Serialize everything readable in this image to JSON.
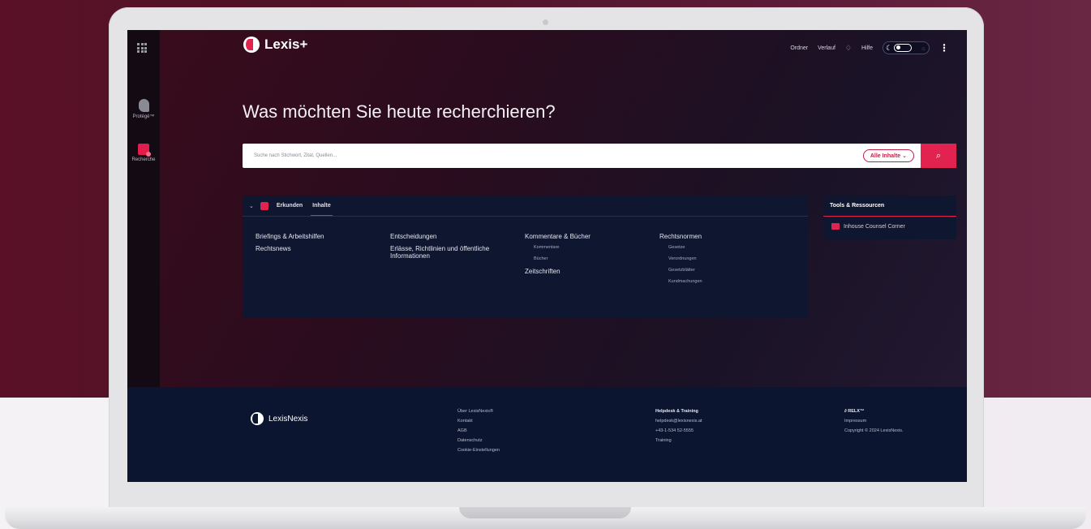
{
  "topnav": {
    "ordner": "Ordner",
    "verlauf": "Verlauf",
    "hilfe": "Hilfe"
  },
  "brand": {
    "name": "Lexis+"
  },
  "rail": {
    "protege": "Protégé™",
    "recherche": "Recherche"
  },
  "headline": "Was möchten Sie heute recherchieren?",
  "search": {
    "placeholder": "Suche nach Stichwort, Zitat, Quellen...",
    "scope": "Alle Inhalte"
  },
  "panel": {
    "tabs": [
      "Erkunden",
      "Inhalte"
    ],
    "columns": [
      {
        "items": [
          {
            "h": "Briefings & Arbeitshilfen"
          },
          {
            "h": "Rechtsnews"
          }
        ]
      },
      {
        "items": [
          {
            "h": "Entscheidungen"
          },
          {
            "h": "Erlässe, Richtlinien und öffentliche Informationen"
          }
        ]
      },
      {
        "heading": "Kommentare & Bücher",
        "subs": [
          "Kommentare",
          "Bücher"
        ],
        "h2": "Zeitschriften"
      },
      {
        "heading": "Rechtsnormen",
        "subs": [
          "Gesetze",
          "Verordnungen",
          "Gesetzblätter",
          "Kundmachungen"
        ]
      }
    ]
  },
  "tools": {
    "title": "Tools & Ressourcen",
    "item": "Inhouse Counsel Corner"
  },
  "footer": {
    "brand": "LexisNexis",
    "col1": [
      "Über LexisNexis®",
      "Kontakt",
      "AGB",
      "Datenschutz",
      "Cookie-Einstellungen"
    ],
    "col2_title": "Helpdesk & Training",
    "col2": [
      "helpdesk@lexisnexis.at",
      "+43-1-534 52-5555",
      "Training"
    ],
    "col3_title": "RELX™",
    "col3": [
      "Impressum",
      "Copyright © 2024 LexisNexis."
    ]
  },
  "colors": {
    "accent": "#e2234f",
    "panel": "#0e1630"
  }
}
